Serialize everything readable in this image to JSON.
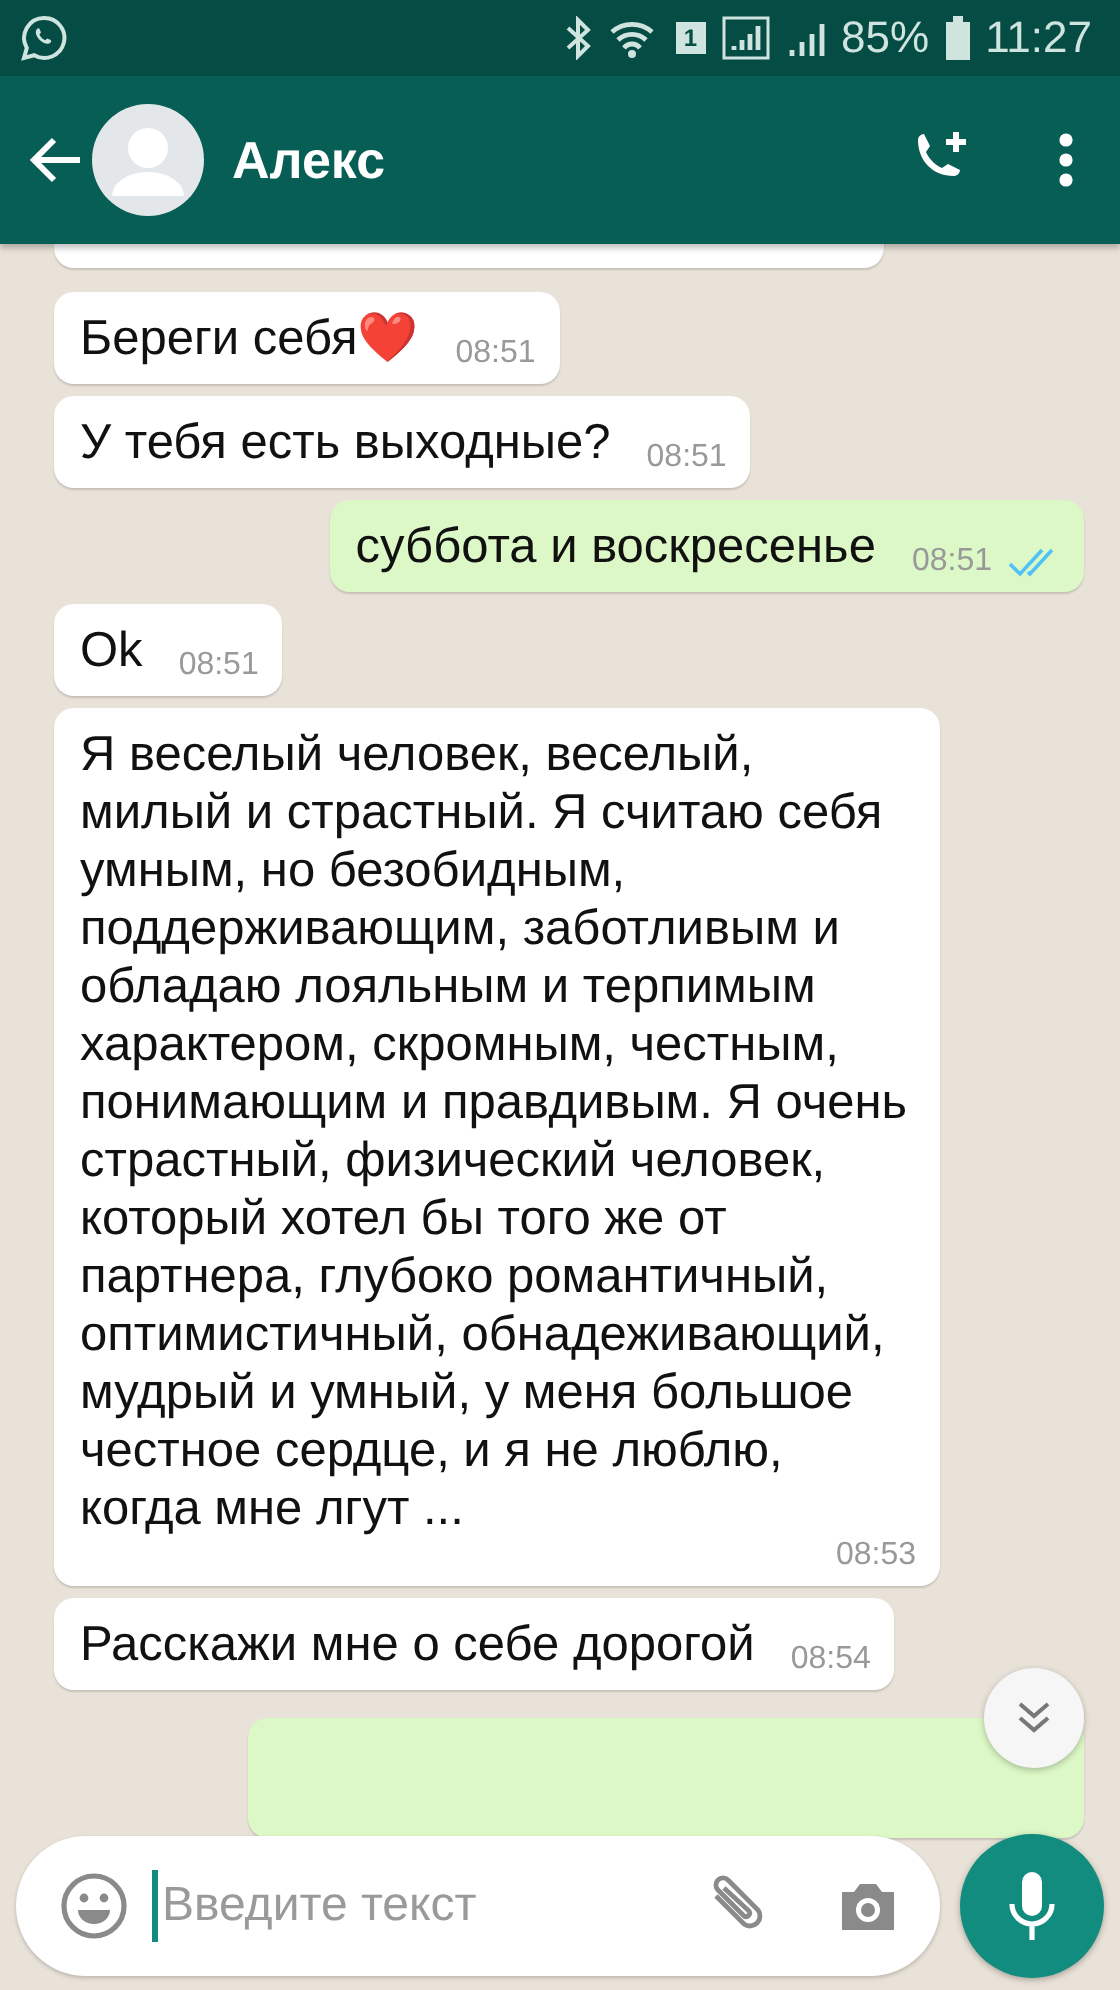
{
  "status_bar": {
    "time": "11:27",
    "battery": "85%",
    "sim": "1"
  },
  "header": {
    "contact_name": "Алекс"
  },
  "messages": [
    {
      "kind": "clipped",
      "outgoing": false
    },
    {
      "kind": "text",
      "outgoing": false,
      "text": "Береги себя❤️",
      "time": "08:51"
    },
    {
      "kind": "text",
      "outgoing": false,
      "text": "У тебя есть выходные?",
      "time": "08:51"
    },
    {
      "kind": "text",
      "outgoing": true,
      "text": "суббота и воскресенье",
      "time": "08:51",
      "read": true
    },
    {
      "kind": "text",
      "outgoing": false,
      "text": "Ok",
      "time": "08:51"
    },
    {
      "kind": "text",
      "outgoing": false,
      "text": "Я веселый человек, веселый, милый и страстный. Я считаю себя умным, но безобидным, поддерживающим, заботливым и обладаю лояльным и терпимым характером, скромным, честным, понимающим и правдивым. Я очень страстный, физический человек, который хотел бы того же от партнера, глубоко романтичный, оптимистичный, обнадеживающий, мудрый и умный, у меня большое честное сердце, и я не люблю, когда мне лгут ...",
      "time": "08:53"
    },
    {
      "kind": "text",
      "outgoing": false,
      "text": "Расскажи мне о себе дорогой",
      "time": "08:54"
    },
    {
      "kind": "clipped",
      "outgoing": true
    }
  ],
  "composer": {
    "placeholder": "Введите текст"
  }
}
